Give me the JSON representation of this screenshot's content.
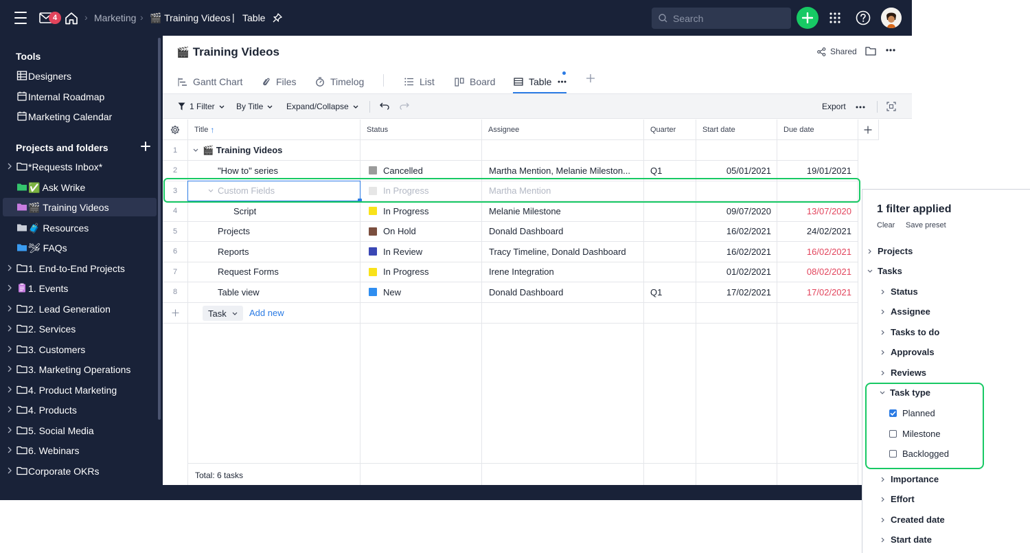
{
  "topbar": {
    "inbox_count": "4",
    "breadcrumb": [
      "Marketing",
      "🎬 Training Videos",
      "Table"
    ],
    "search_placeholder": "Search"
  },
  "sidebar": {
    "tools_heading": "Tools",
    "tools": [
      {
        "label": "Designers",
        "icon": "grid-icon"
      },
      {
        "label": "Internal Roadmap",
        "icon": "calendar-icon"
      },
      {
        "label": "Marketing Calendar",
        "icon": "calendar-icon"
      }
    ],
    "projects_heading": "Projects and folders",
    "items": [
      {
        "label": "*Requests Inbox*",
        "icon": "folder-icon",
        "chevron": true
      },
      {
        "label": "✅ Ask Wrike",
        "icon": "folder-green-icon",
        "chevron": false
      },
      {
        "label": "🎬 Training Videos",
        "icon": "folder-purple-icon",
        "chevron": false,
        "selected": true
      },
      {
        "label": "🧳 Resources",
        "icon": "folder-gray-icon",
        "chevron": false
      },
      {
        "label": "🛩 FAQs",
        "icon": "folder-blue-icon",
        "chevron": false
      },
      {
        "label": "1. End-to-End Projects",
        "icon": "folder-icon",
        "chevron": true
      },
      {
        "label": "1. Events",
        "icon": "clipboard-icon",
        "chevron": true
      },
      {
        "label": "2. Lead Generation",
        "icon": "folder-icon",
        "chevron": true
      },
      {
        "label": "2. Services",
        "icon": "folder-icon",
        "chevron": true
      },
      {
        "label": "3. Customers",
        "icon": "folder-icon",
        "chevron": true
      },
      {
        "label": "3. Marketing Operations",
        "icon": "folder-icon",
        "chevron": true
      },
      {
        "label": "4. Product Marketing",
        "icon": "folder-icon",
        "chevron": true
      },
      {
        "label": "4. Products",
        "icon": "folder-icon",
        "chevron": true
      },
      {
        "label": "5. Social Media",
        "icon": "folder-icon",
        "chevron": true
      },
      {
        "label": "6. Webinars",
        "icon": "folder-icon",
        "chevron": true
      },
      {
        "label": "Corporate OKRs",
        "icon": "folder-icon",
        "chevron": true
      }
    ]
  },
  "page": {
    "title": "Training Videos",
    "shared_label": "Shared"
  },
  "tabs": [
    {
      "label": "Gantt Chart",
      "icon": "gantt-icon"
    },
    {
      "label": "Files",
      "icon": "paperclip-icon"
    },
    {
      "label": "Timelog",
      "icon": "stopwatch-icon"
    },
    {
      "label": "List",
      "icon": "list-icon"
    },
    {
      "label": "Board",
      "icon": "board-icon"
    },
    {
      "label": "Table",
      "icon": "table-icon",
      "active": true
    }
  ],
  "toolbar": {
    "filter_label": "1 Filter",
    "sort_label": "By Title",
    "expand_label": "Expand/Collapse",
    "export_label": "Export"
  },
  "table": {
    "headers": [
      "Title",
      "Status",
      "Assignee",
      "Quarter",
      "Start date",
      "Due date"
    ],
    "rows": [
      {
        "num": "1",
        "title": "🎬 Training Videos",
        "status": "",
        "color": "",
        "assignee": "",
        "quarter": "",
        "start": "",
        "due": "",
        "due_overdue": false
      },
      {
        "num": "2",
        "title": "\"How to\" series",
        "status": "Cancelled",
        "color": "#9b9b9b",
        "assignee": "Martha Mention, Melanie Mileston...",
        "quarter": "Q1",
        "start": "05/01/2021",
        "due": "19/01/2021",
        "due_overdue": false
      },
      {
        "num": "3",
        "title": "Custom Fields",
        "status": "In Progress",
        "color": "#e6e6e6",
        "assignee": "Martha Mention",
        "quarter": "",
        "start": "",
        "due": "",
        "due_overdue": false
      },
      {
        "num": "4",
        "title": "Script",
        "status": "In Progress",
        "color": "#f9e21a",
        "assignee": "Melanie Milestone",
        "quarter": "",
        "start": "09/07/2020",
        "due": "13/07/2020",
        "due_overdue": true
      },
      {
        "num": "5",
        "title": "Projects",
        "status": "On Hold",
        "color": "#7b4f3f",
        "assignee": "Donald Dashboard",
        "quarter": "",
        "start": "16/02/2021",
        "due": "24/02/2021",
        "due_overdue": false
      },
      {
        "num": "6",
        "title": "Reports",
        "status": "In Review",
        "color": "#3a47b5",
        "assignee": "Tracy Timeline, Donald Dashboard",
        "quarter": "",
        "start": "16/02/2021",
        "due": "16/02/2021",
        "due_overdue": true
      },
      {
        "num": "7",
        "title": "Request Forms",
        "status": "In Progress",
        "color": "#f9e21a",
        "assignee": "Irene Integration",
        "quarter": "",
        "start": "01/02/2021",
        "due": "08/02/2021",
        "due_overdue": true
      },
      {
        "num": "8",
        "title": "Table view",
        "status": "New",
        "color": "#2f8ef0",
        "assignee": "Donald Dashboard",
        "quarter": "Q1",
        "start": "17/02/2021",
        "due": "17/02/2021",
        "due_overdue": true
      }
    ],
    "new_type_label": "Task",
    "add_new_label": "Add new",
    "total_label": "Total: 6 tasks"
  },
  "filter_panel": {
    "title": "1 filter applied",
    "clear_label": "Clear",
    "save_preset_label": "Save preset",
    "sections": {
      "projects": "Projects",
      "tasks": "Tasks",
      "status": "Status",
      "assignee": "Assignee",
      "tasks_to_do": "Tasks to do",
      "approvals": "Approvals",
      "reviews": "Reviews",
      "task_type": "Task type",
      "importance": "Importance",
      "effort": "Effort",
      "created_date": "Created date",
      "start_date": "Start date"
    },
    "task_type_options": [
      {
        "label": "Planned",
        "checked": true
      },
      {
        "label": "Milestone",
        "checked": false
      },
      {
        "label": "Backlogged",
        "checked": false
      }
    ]
  },
  "colors": {
    "nav_bg": "#192238",
    "accent_green": "#17c964",
    "accent_blue": "#2b7be4",
    "overdue_red": "#e2445c"
  }
}
